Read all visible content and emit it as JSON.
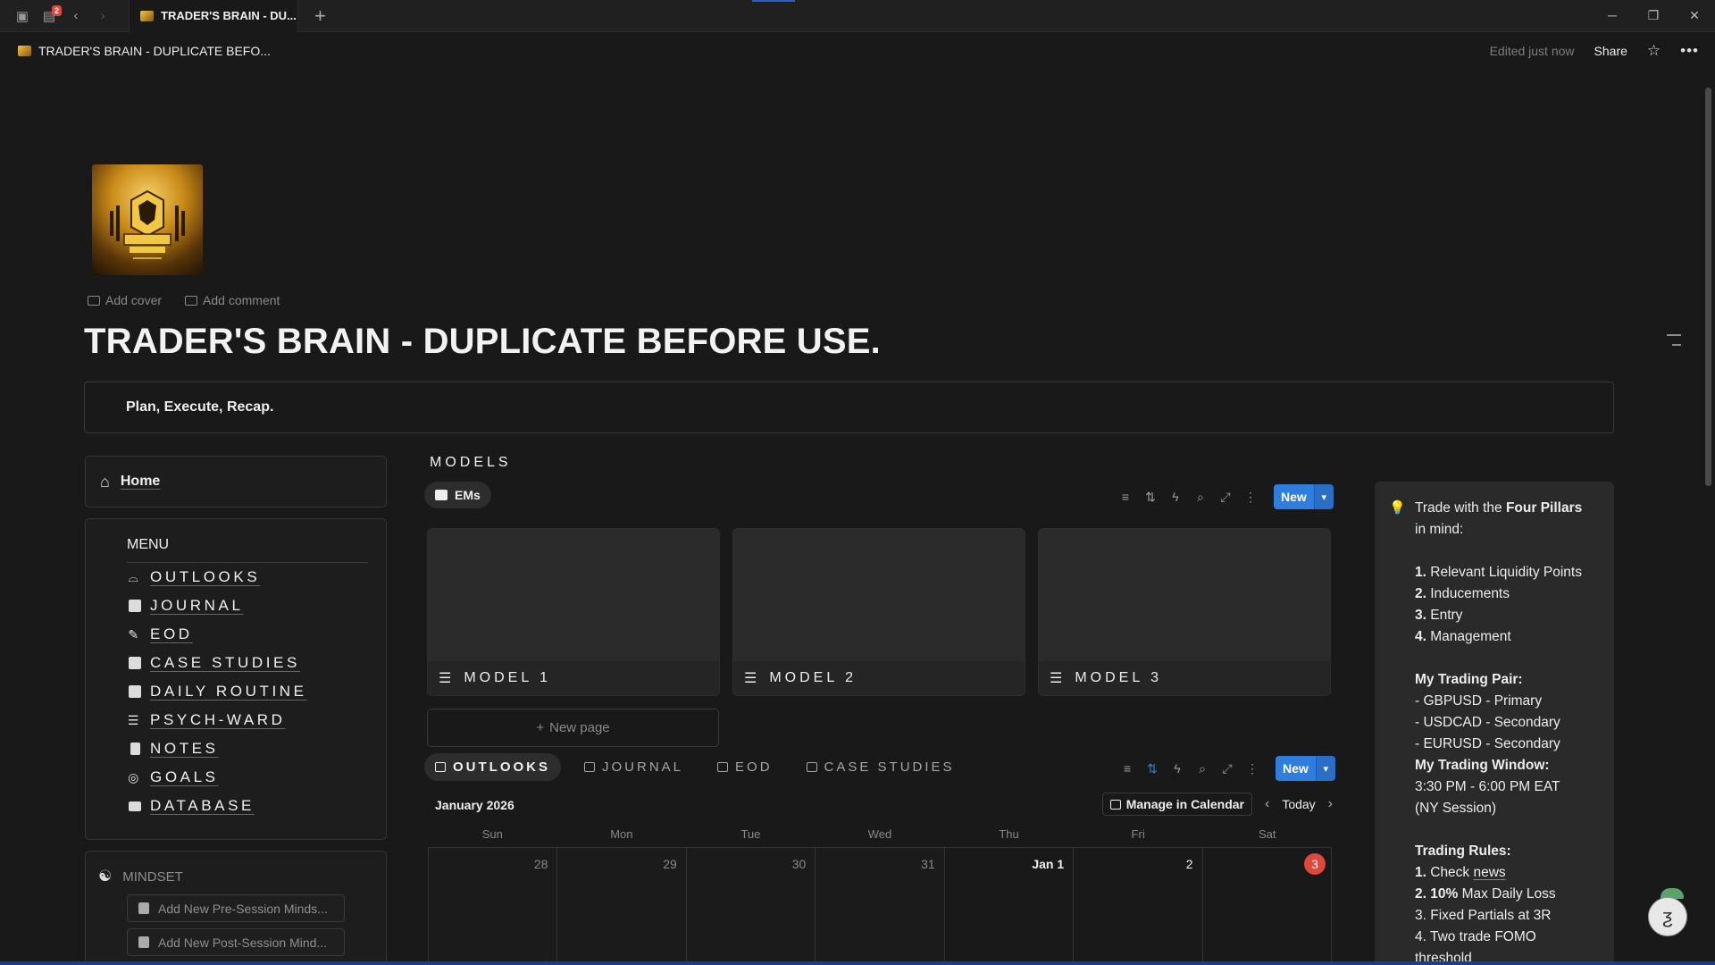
{
  "browser": {
    "tab_title": "TRADER'S BRAIN - DU...",
    "tab_badge": "2",
    "new_tab_icon": "plus-icon"
  },
  "topbar": {
    "breadcrumb": "TRADER'S BRAIN - DUPLICATE BEFO...",
    "edited": "Edited just now",
    "share": "Share"
  },
  "page": {
    "add_cover": "Add cover",
    "add_comment": "Add comment",
    "title": "TRADER'S BRAIN - DUPLICATE BEFORE USE.",
    "tagline": "Plan, Execute, Recap."
  },
  "left": {
    "home": "Home",
    "menu_title": "MENU",
    "menu_items": [
      {
        "label": "OUTLOOKS",
        "icon": "glasses-icon"
      },
      {
        "label": "JOURNAL",
        "icon": "book-icon"
      },
      {
        "label": "EOD",
        "icon": "wrench-icon"
      },
      {
        "label": "CASE STUDIES",
        "icon": "notebook-icon"
      },
      {
        "label": "DAILY ROUTINE",
        "icon": "calendar-icon"
      },
      {
        "label": "PSYCH-WARD",
        "icon": "checklist-icon"
      },
      {
        "label": "NOTES",
        "icon": "document-icon"
      },
      {
        "label": "GOALS",
        "icon": "target-icon"
      },
      {
        "label": "DATABASE",
        "icon": "folder-icon"
      }
    ],
    "mindset_title": "MINDSET",
    "mindset_buttons": [
      "Add New Pre-Session Minds...",
      "Add New Post-Session Mind..."
    ]
  },
  "models": {
    "title": "MODELS",
    "view": "EMs",
    "new_label": "New",
    "cards": [
      "MODEL 1",
      "MODEL 2",
      "MODEL 3"
    ],
    "new_page": "New page"
  },
  "calendar": {
    "tabs": [
      "OUTLOOKS",
      "JOURNAL",
      "EOD",
      "CASE STUDIES"
    ],
    "active_tab": "OUTLOOKS",
    "new_label": "New",
    "month": "January 2026",
    "manage": "Manage in Calendar",
    "today": "Today",
    "weekdays": [
      "Sun",
      "Mon",
      "Tue",
      "Wed",
      "Thu",
      "Fri",
      "Sat"
    ],
    "dates": [
      "28",
      "29",
      "30",
      "31",
      "Jan 1",
      "2",
      "3"
    ],
    "today_date": "3",
    "today_color": "#e0473c"
  },
  "callout": {
    "line1_pre": "Trade with the ",
    "line1_bold": "Four Pillars",
    "line2": "in mind:",
    "pillars": [
      {
        "num": "1.",
        "text": " Relevant Liquidity Points"
      },
      {
        "num": "2.",
        "text": " Inducements"
      },
      {
        "num": "3.",
        "text": " Entry"
      },
      {
        "num": "4.",
        "text": " Management"
      }
    ],
    "pair_title": "My Trading Pair:",
    "pairs": [
      "- GBPUSD - Primary",
      "- USDCAD - Secondary",
      "- EURUSD - Secondary"
    ],
    "window_title": "My Trading Window:",
    "window_time": "3:30 PM - 6:00 PM EAT",
    "window_session": "(NY Session)",
    "rules_title": "Trading Rules:",
    "rule1_num": "1.",
    "rule1_pre": " Check ",
    "rule1_link": "news",
    "rule2_num": "2.",
    "rule2_bold": " 10%",
    "rule2_text": " Max Daily Loss",
    "rule3": "3. Fixed Partials at 3R",
    "rule4": "4. Two trade FOMO",
    "rule4b": "threshold"
  },
  "colors": {
    "accent": "#2f7ddc",
    "background": "#191919",
    "today": "#e0473c"
  }
}
